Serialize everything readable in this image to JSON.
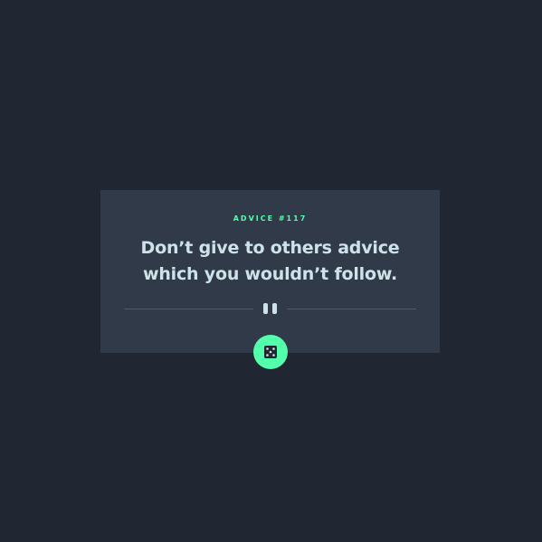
{
  "card": {
    "advice_label": "ADVICE #117",
    "advice_text": "Don’t give to others advice which you wouldn’t follow."
  },
  "colors": {
    "background": "#202733",
    "card": "#313a48",
    "accent": "#53ffaa",
    "text": "#cee3e9",
    "divider": "#4f5b6b"
  },
  "icons": {
    "divider_icon": "pause-icon",
    "button_icon": "dice-icon"
  }
}
